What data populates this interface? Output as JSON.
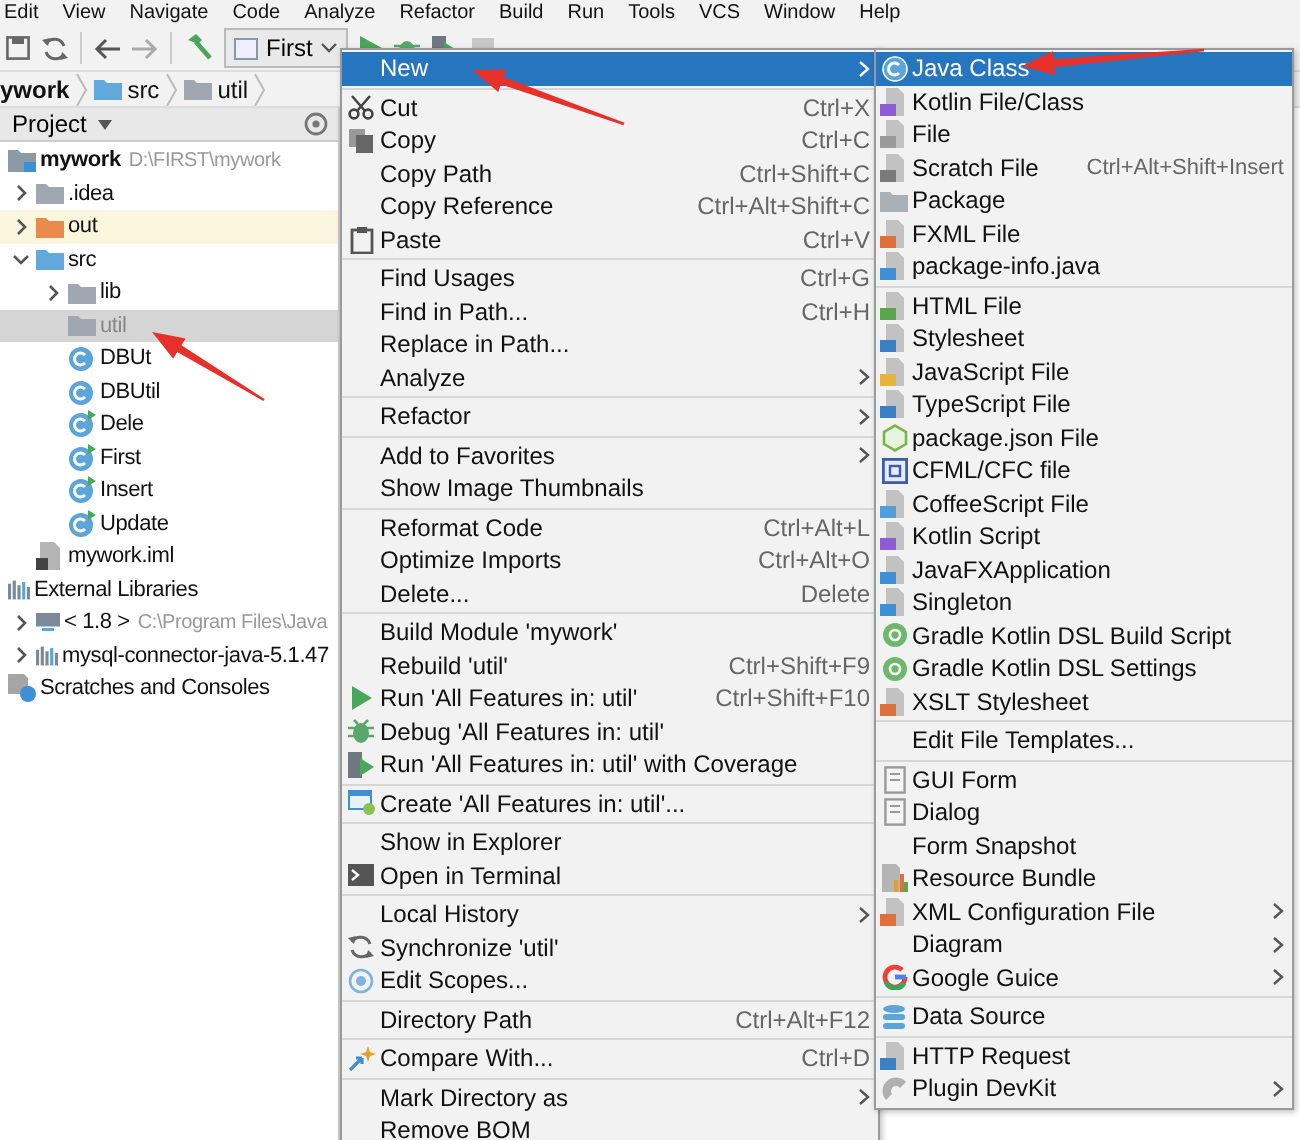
{
  "menu_bar": [
    "Edit",
    "View",
    "Navigate",
    "Code",
    "Analyze",
    "Refactor",
    "Build",
    "Run",
    "Tools",
    "VCS",
    "Window",
    "Help"
  ],
  "toolbar": {
    "run_config": "First"
  },
  "breadcrumbs": [
    "ywork",
    "src",
    "util"
  ],
  "project_panel": {
    "title": "Project"
  },
  "tree": [
    {
      "label": "mywork",
      "hint": "D:\\FIRST\\mywork",
      "kind": "module",
      "selected": false,
      "children": [
        {
          "label": ".idea",
          "kind": "folder",
          "expanded": false,
          "selected": false
        },
        {
          "label": "out",
          "kind": "excluded-folder",
          "expanded": false,
          "selected": false
        },
        {
          "label": "src",
          "kind": "source-folder",
          "expanded": true,
          "selected": false,
          "children": [
            {
              "label": "lib",
              "kind": "package",
              "expanded": false,
              "selected": false
            },
            {
              "label": "util",
              "kind": "package",
              "selected": true
            },
            {
              "label": "DBUt",
              "kind": "class",
              "selected": false
            },
            {
              "label": "DBUtil",
              "kind": "class",
              "selected": false
            },
            {
              "label": "Dele",
              "kind": "runnable-class",
              "selected": false
            },
            {
              "label": "First",
              "kind": "runnable-class",
              "selected": false
            },
            {
              "label": "Insert",
              "kind": "runnable-class",
              "selected": false
            },
            {
              "label": "Update",
              "kind": "runnable-class",
              "selected": false
            }
          ]
        },
        {
          "label": "mywork.iml",
          "kind": "module-file",
          "selected": false
        }
      ]
    },
    {
      "label": "External Libraries",
      "kind": "libraries",
      "selected": false,
      "children": [
        {
          "label": "< 1.8 >",
          "hint": "C:\\Program Files\\Java",
          "kind": "sdk",
          "expanded": false,
          "selected": false
        },
        {
          "label": "mysql-connector-java-5.1.47",
          "kind": "library",
          "expanded": false,
          "selected": false
        }
      ]
    },
    {
      "label": "Scratches and Consoles",
      "kind": "scratches",
      "selected": false
    }
  ],
  "context_menu": {
    "sections": [
      {
        "items": [
          {
            "label": "New",
            "kind": "plain",
            "submenu": true,
            "selected": true
          }
        ]
      },
      {
        "items": [
          {
            "label": "Cut",
            "kind": "cut",
            "shortcut": "Ctrl+X",
            "selected": false
          },
          {
            "label": "Copy",
            "kind": "copy",
            "shortcut": "Ctrl+C",
            "selected": false
          },
          {
            "label": "Copy Path",
            "kind": "plain",
            "shortcut": "Ctrl+Shift+C",
            "selected": false
          },
          {
            "label": "Copy Reference",
            "kind": "plain",
            "shortcut": "Ctrl+Alt+Shift+C",
            "selected": false
          },
          {
            "label": "Paste",
            "kind": "paste",
            "shortcut": "Ctrl+V",
            "selected": false
          }
        ]
      },
      {
        "items": [
          {
            "label": "Find Usages",
            "kind": "plain",
            "shortcut": "Ctrl+G",
            "selected": false
          },
          {
            "label": "Find in Path...",
            "kind": "plain",
            "shortcut": "Ctrl+H",
            "selected": false
          },
          {
            "label": "Replace in Path...",
            "kind": "plain",
            "selected": false
          },
          {
            "label": "Analyze",
            "kind": "plain",
            "submenu": true,
            "selected": false
          }
        ]
      },
      {
        "items": [
          {
            "label": "Refactor",
            "kind": "plain",
            "submenu": true,
            "selected": false
          }
        ]
      },
      {
        "items": [
          {
            "label": "Add to Favorites",
            "kind": "plain",
            "submenu": true,
            "selected": false
          },
          {
            "label": "Show Image Thumbnails",
            "kind": "plain",
            "selected": false
          }
        ]
      },
      {
        "items": [
          {
            "label": "Reformat Code",
            "kind": "plain",
            "shortcut": "Ctrl+Alt+L",
            "selected": false
          },
          {
            "label": "Optimize Imports",
            "kind": "plain",
            "shortcut": "Ctrl+Alt+O",
            "selected": false
          },
          {
            "label": "Delete...",
            "kind": "plain",
            "shortcut": "Delete",
            "selected": false
          }
        ]
      },
      {
        "items": [
          {
            "label": "Build Module 'mywork'",
            "kind": "plain",
            "selected": false
          },
          {
            "label": "Rebuild 'util'",
            "kind": "plain",
            "shortcut": "Ctrl+Shift+F9",
            "selected": false
          },
          {
            "label": "Run 'All Features in: util'",
            "kind": "run",
            "shortcut": "Ctrl+Shift+F10",
            "selected": false
          },
          {
            "label": "Debug 'All Features in: util'",
            "kind": "debug",
            "selected": false
          },
          {
            "label": "Run 'All Features in: util' with Coverage",
            "kind": "coverage",
            "selected": false
          }
        ]
      },
      {
        "items": [
          {
            "label": "Create 'All Features in: util'...",
            "kind": "create",
            "selected": false
          }
        ]
      },
      {
        "items": [
          {
            "label": "Show in Explorer",
            "kind": "plain",
            "selected": false
          },
          {
            "label": "Open in Terminal",
            "kind": "terminal",
            "selected": false
          }
        ]
      },
      {
        "items": [
          {
            "label": "Local History",
            "kind": "plain",
            "submenu": true,
            "selected": false
          },
          {
            "label": "Synchronize 'util'",
            "kind": "sync",
            "selected": false
          },
          {
            "label": "Edit Scopes...",
            "kind": "scope",
            "selected": false
          }
        ]
      },
      {
        "items": [
          {
            "label": "Directory Path",
            "kind": "plain",
            "shortcut": "Ctrl+Alt+F12",
            "selected": false
          }
        ]
      },
      {
        "items": [
          {
            "label": "Compare With...",
            "kind": "compare",
            "shortcut": "Ctrl+D",
            "selected": false
          }
        ]
      },
      {
        "items": [
          {
            "label": "Mark Directory as",
            "kind": "plain",
            "submenu": true,
            "selected": false
          },
          {
            "label": "Remove BOM",
            "kind": "plain",
            "selected": false
          }
        ]
      }
    ]
  },
  "new_submenu": {
    "sections": [
      {
        "items": [
          {
            "label": "Java Class",
            "kind": "java-class",
            "selected": true
          },
          {
            "label": "Kotlin File/Class",
            "kind": "kotlin",
            "selected": false
          },
          {
            "label": "File",
            "kind": "file",
            "selected": false
          },
          {
            "label": "Scratch File",
            "kind": "scratch",
            "shortcut": "Ctrl+Alt+Shift+Insert",
            "selected": false
          },
          {
            "label": "Package",
            "kind": "package",
            "selected": false
          },
          {
            "label": "FXML File",
            "kind": "fxml",
            "selected": false
          },
          {
            "label": "package-info.java",
            "kind": "java-file",
            "selected": false
          }
        ]
      },
      {
        "items": [
          {
            "label": "HTML File",
            "kind": "html",
            "selected": false
          },
          {
            "label": "Stylesheet",
            "kind": "css",
            "selected": false
          },
          {
            "label": "JavaScript File",
            "kind": "js",
            "selected": false
          },
          {
            "label": "TypeScript File",
            "kind": "ts",
            "selected": false
          },
          {
            "label": "package.json File",
            "kind": "json",
            "selected": false
          },
          {
            "label": "CFML/CFC file",
            "kind": "cfml",
            "selected": false
          },
          {
            "label": "CoffeeScript File",
            "kind": "coffee",
            "selected": false
          },
          {
            "label": "Kotlin Script",
            "kind": "kotlin",
            "selected": false
          },
          {
            "label": "JavaFXApplication",
            "kind": "java-file",
            "selected": false
          },
          {
            "label": "Singleton",
            "kind": "java-file",
            "selected": false
          },
          {
            "label": "Gradle Kotlin DSL Build Script",
            "kind": "gradle",
            "selected": false
          },
          {
            "label": "Gradle Kotlin DSL Settings",
            "kind": "gradle",
            "selected": false
          },
          {
            "label": "XSLT Stylesheet",
            "kind": "xml",
            "selected": false
          }
        ]
      },
      {
        "items": [
          {
            "label": "Edit File Templates...",
            "kind": "plain",
            "selected": false
          }
        ]
      },
      {
        "items": [
          {
            "label": "GUI Form",
            "kind": "form",
            "selected": false
          },
          {
            "label": "Dialog",
            "kind": "form",
            "selected": false
          },
          {
            "label": "Form Snapshot",
            "kind": "plain",
            "selected": false
          },
          {
            "label": "Resource Bundle",
            "kind": "bundle",
            "selected": false
          },
          {
            "label": "XML Configuration File",
            "kind": "xml",
            "submenu": true,
            "selected": false
          },
          {
            "label": "Diagram",
            "kind": "plain",
            "submenu": true,
            "selected": false
          },
          {
            "label": "Google Guice",
            "kind": "google",
            "submenu": true,
            "selected": false
          }
        ]
      },
      {
        "items": [
          {
            "label": "Data Source",
            "kind": "database",
            "selected": false
          }
        ]
      },
      {
        "items": [
          {
            "label": "HTTP Request",
            "kind": "http",
            "selected": false
          },
          {
            "label": "Plugin DevKit",
            "kind": "plugin",
            "submenu": true,
            "selected": false
          }
        ]
      }
    ]
  }
}
